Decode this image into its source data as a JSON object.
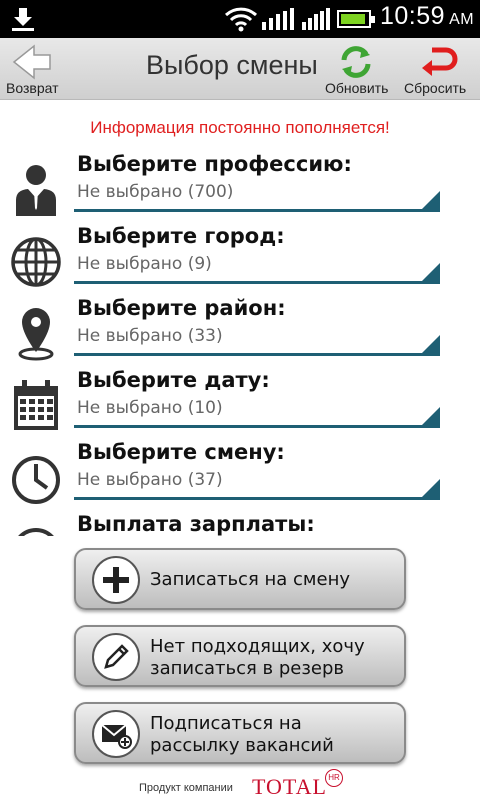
{
  "statusbar": {
    "time": "10:59",
    "ampm": "AM"
  },
  "header": {
    "back_label": "Возврат",
    "title": "Выбор смены",
    "refresh_label": "Обновить",
    "reset_label": "Сбросить"
  },
  "info_text": "Информация постоянно пополняется!",
  "selectors": [
    {
      "label": "Выберите профессию:",
      "value": "Не выбрано (700)",
      "icon": "person-icon"
    },
    {
      "label": "Выберите город:",
      "value": "Не выбрано (9)",
      "icon": "globe-icon"
    },
    {
      "label": "Выберите район:",
      "value": "Не выбрано (33)",
      "icon": "location-pin-icon"
    },
    {
      "label": "Выберите дату:",
      "value": "Не выбрано (10)",
      "icon": "calendar-icon"
    },
    {
      "label": "Выберите смену:",
      "value": "Не выбрано (37)",
      "icon": "clock-icon"
    },
    {
      "label": "Выплата зарплаты:",
      "value": "",
      "icon": "clock-icon"
    }
  ],
  "buttons": {
    "enroll": "Записаться на смену",
    "reserve_line1": "Нет подходящих, хочу",
    "reserve_line2": "записаться в резерв",
    "subscribe_line1": "Подписаться на",
    "subscribe_line2": "рассылку вакансий"
  },
  "footer": {
    "product": "Продукт компании",
    "brand": "TOTAL",
    "badge": "HR"
  },
  "colors": {
    "accent": "#1e5f74",
    "info": "#e02020",
    "brand": "#c8102e"
  }
}
